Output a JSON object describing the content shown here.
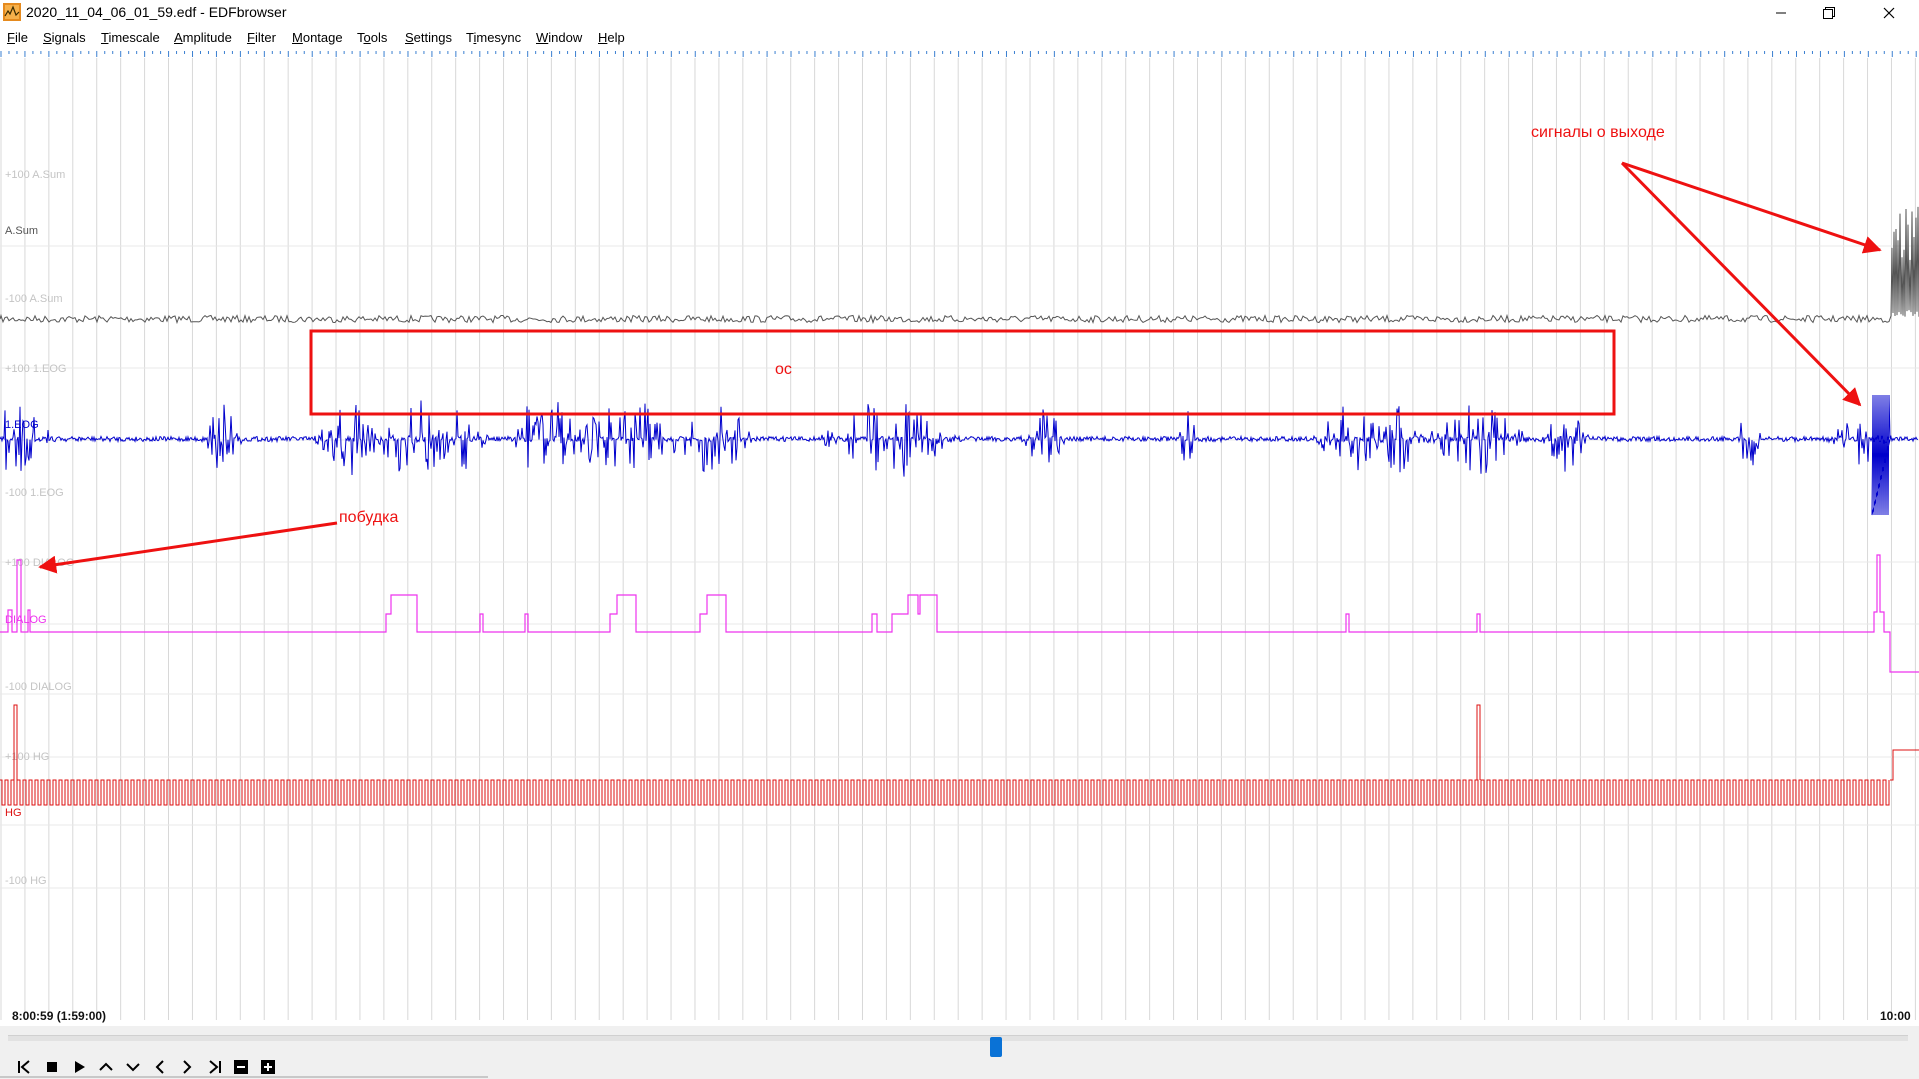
{
  "window": {
    "title": "2020_11_04_06_01_59.edf - EDFbrowser",
    "controls": {
      "minimize": "minimize",
      "restore": "restore",
      "close": "close"
    }
  },
  "menu": [
    {
      "label": "File",
      "ul": "F",
      "rest": "ile"
    },
    {
      "label": "Signals",
      "ul": "S",
      "rest": "ignals"
    },
    {
      "label": "Timescale",
      "ul": "T",
      "rest": "imescale"
    },
    {
      "label": "Amplitude",
      "ul": "A",
      "rest": "mplitude"
    },
    {
      "label": "Filter",
      "ul": "F",
      "rest": "ilter"
    },
    {
      "label": "Montage",
      "ul": "M",
      "rest": "ontage"
    },
    {
      "label": "Tools",
      "pre": "T",
      "ul": "o",
      "rest": "ols"
    },
    {
      "label": "Settings",
      "ul": "S",
      "rest": "ettings"
    },
    {
      "label": "Timesync",
      "pre": "T",
      "ul": "i",
      "rest": "mesync"
    },
    {
      "label": "Window",
      "ul": "W",
      "rest": "indow"
    },
    {
      "label": "Help",
      "ul": "H",
      "rest": "elp"
    }
  ],
  "signals": {
    "asum": {
      "label": "A.Sum",
      "upper": "+100 A.Sum",
      "lower": "-100 A.Sum",
      "color": "#555555"
    },
    "eog": {
      "label": "1.EOG",
      "upper": "+100 1.EOG",
      "lower": "-100 1.EOG",
      "color": "#0000cc"
    },
    "dialog": {
      "label": "DIALOG",
      "upper": "+100 DIALOG",
      "lower": "-100 DIALOG",
      "color": "#ee33ee"
    },
    "hg": {
      "label": "HG",
      "upper": "+100 HG",
      "lower": "-100 HG",
      "color": "#dd1111"
    }
  },
  "time": {
    "start": "8:00:59 (1:59:00)",
    "end": "10:00"
  },
  "annotations": {
    "box_label": "ос",
    "wake_label": "побудка",
    "exit_label": "сигналы о выходе",
    "color": "#ee1111"
  },
  "nav_buttons": [
    "skip-start",
    "stop",
    "play",
    "amp-up",
    "amp-down",
    "back",
    "forward",
    "skip-end",
    "zoom-out",
    "zoom-in"
  ],
  "colors": {
    "grid": "#d8d8d8",
    "ruler": "#3a7fd0",
    "accent": "#0a72d6"
  },
  "scroll_position": 0.52
}
